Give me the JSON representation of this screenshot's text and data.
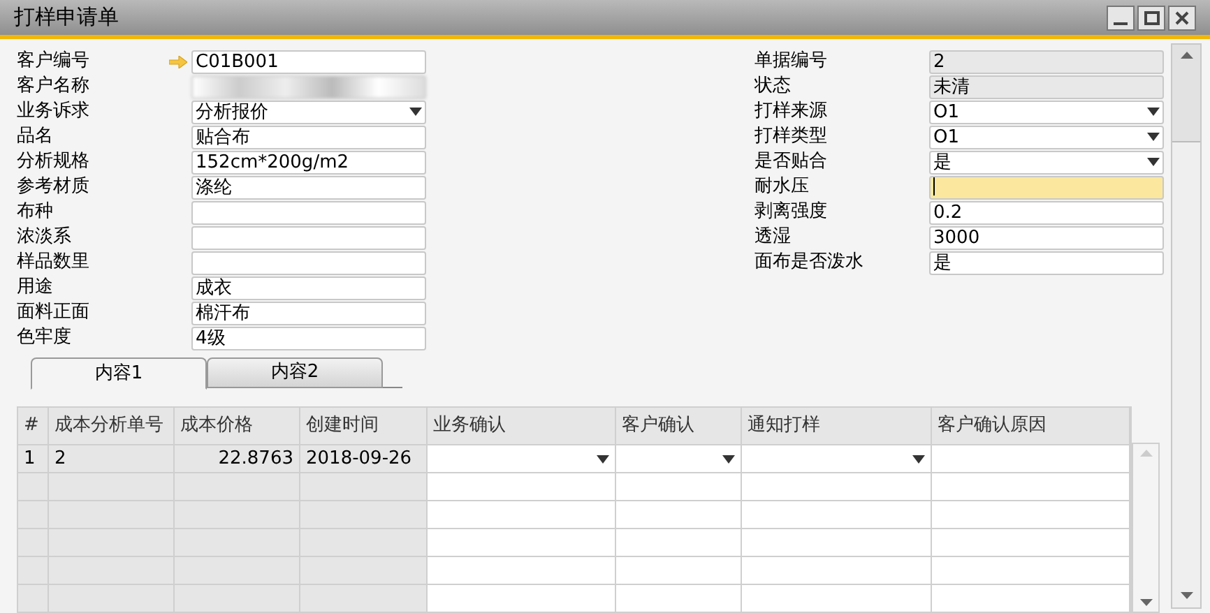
{
  "window": {
    "title": "打样申请单"
  },
  "left_fields": [
    {
      "label": "客户编号",
      "kind": "link",
      "value": "C01B001",
      "focused": false
    },
    {
      "label": "客户名称",
      "kind": "blurred"
    },
    {
      "label": "业务诉求",
      "kind": "dropdown",
      "value": "分析报价",
      "focused": false
    },
    {
      "label": "品名",
      "kind": "text",
      "value": "贴合布",
      "focused": false
    },
    {
      "label": "分析规格",
      "kind": "text",
      "value": "152cm*200g/m2",
      "focused": false
    },
    {
      "label": "参考材质",
      "kind": "text",
      "value": "涤纶",
      "focused": false
    },
    {
      "label": "布种",
      "kind": "text",
      "focused": false
    },
    {
      "label": "浓淡系",
      "kind": "text",
      "focused": false
    },
    {
      "label": "样品数里",
      "kind": "text",
      "focused": false
    },
    {
      "label": "用途",
      "kind": "text",
      "value": "成衣",
      "focused": false
    },
    {
      "label": "面料正面",
      "kind": "text",
      "value": "棉汗布",
      "focused": false
    },
    {
      "label": "色牢度",
      "kind": "text",
      "value": "4级",
      "focused": false
    }
  ],
  "right_fields": [
    {
      "label": "单据编号",
      "kind": "readonly",
      "value": "2",
      "focused": false
    },
    {
      "label": "状态",
      "kind": "readonly",
      "value": "未清",
      "focused": false
    },
    {
      "label": "打样来源",
      "kind": "dropdown",
      "value": "O1",
      "focused": false
    },
    {
      "label": "打样类型",
      "kind": "dropdown",
      "value": "O1",
      "focused": false
    },
    {
      "label": "是否贴合",
      "kind": "dropdown",
      "value": "是",
      "focused": false
    },
    {
      "label": "耐水压",
      "kind": "text",
      "focused": true
    },
    {
      "label": "剥离强度",
      "kind": "text",
      "value": "0.2",
      "focused": false
    },
    {
      "label": "透湿",
      "kind": "text",
      "value": "3000",
      "focused": false
    },
    {
      "label": "面布是否泼水",
      "kind": "text",
      "value": "是",
      "focused": false
    }
  ],
  "tabs": [
    {
      "label": "内容1",
      "selected": true
    },
    {
      "label": "内容2",
      "selected": false
    }
  ],
  "table": {
    "columns": [
      {
        "label": "#",
        "kind": "index"
      },
      {
        "label": "成本分析单号",
        "kind": "readonly"
      },
      {
        "label": "成本价格",
        "kind": "readonly"
      },
      {
        "label": "创建时间",
        "kind": "readonly"
      },
      {
        "label": "业务确认",
        "kind": "dropdown"
      },
      {
        "label": "客户确认",
        "kind": "dropdown"
      },
      {
        "label": "通知打样",
        "kind": "dropdown"
      },
      {
        "label": "客户确认原因",
        "kind": "text"
      }
    ],
    "rows": [
      [
        "1",
        "2",
        "22.8763",
        "2018-09-26",
        "",
        "",
        "",
        ""
      ]
    ]
  }
}
